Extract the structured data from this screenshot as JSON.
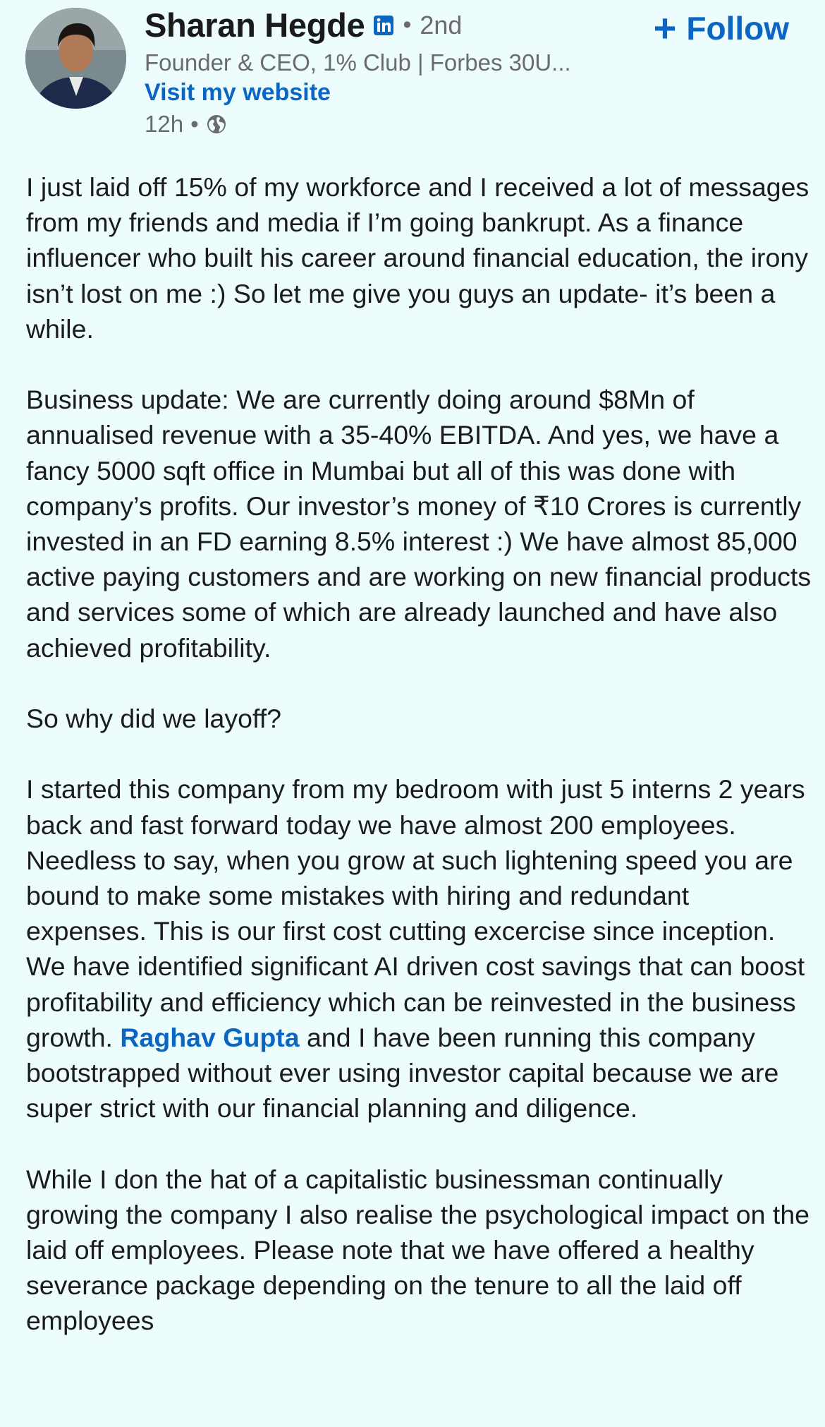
{
  "author": {
    "name": "Sharan Hegde",
    "degree": "2nd",
    "separator": "•",
    "headline": "Founder & CEO, 1% Club | Forbes 30U...",
    "website_label": "Visit my website",
    "time_ago": "12h",
    "meta_separator": "•",
    "visibility_icon": "globe-icon",
    "badge_icon": "linkedin-icon"
  },
  "follow": {
    "label": "Follow",
    "icon": "plus-icon"
  },
  "post": {
    "p1": "I just laid off 15% of my workforce and I received a lot of messages from my friends and media if I’m going bankrupt. As a finance influencer who built his career around financial education, the irony isn’t lost on me :) So let me give you guys an update- it’s been a while.",
    "p2": "Business update: We are currently doing around $8Mn of annualised revenue with a 35-40% EBITDA. And yes, we have a fancy 5000 sqft office in Mumbai but all of this was done with company’s profits. Our investor’s money of ₹10 Crores is currently invested in an FD earning 8.5% interest :) We have almost 85,000 active paying customers and are working on new financial products and services some of which are already launched and have also achieved profitability.",
    "p3": "So why did we layoff?",
    "p4_before": "I started this company from my bedroom with just 5 interns 2 years back and fast forward today we have almost 200 employees. Needless to say, when you grow at such lightening speed you are bound to make some mistakes with hiring and redundant expenses. This is our first cost cutting excercise since inception. We have identified significant AI driven cost savings that can boost profitability and efficiency which can be reinvested in the business growth. ",
    "p4_mention": "Raghav Gupta",
    "p4_after": " and I have been running this company bootstrapped without ever using investor capital because we are super strict with our financial planning and diligence.",
    "p5": "While I don the hat of a capitalistic businessman continually growing the company I also realise the psychological impact on the laid off employees. Please note that we have offered a healthy severance package depending on the tenure to all the laid off employees"
  },
  "colors": {
    "background": "#edfcfd",
    "link_blue": "#0a66c2",
    "secondary_text": "#6b6b6b",
    "primary_text": "#1c1c1e"
  }
}
